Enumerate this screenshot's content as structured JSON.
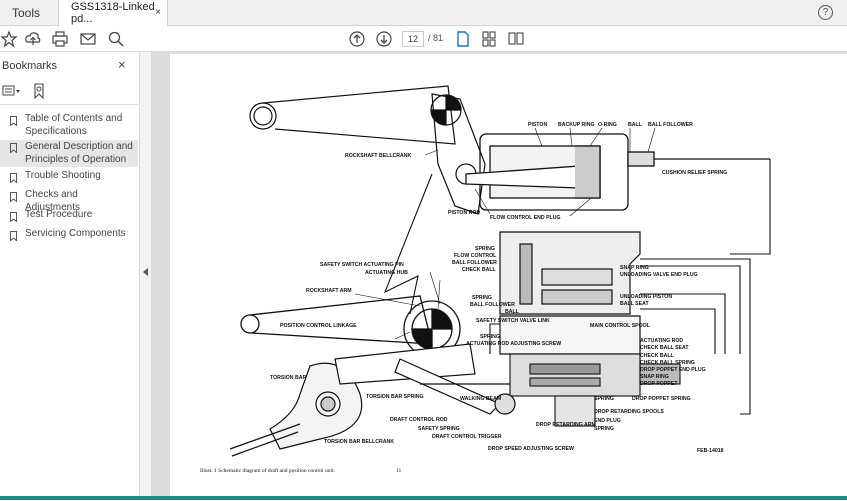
{
  "tabs": {
    "tools": "Tools",
    "doc_title": "GSS1318-Linked pd...",
    "close": "×"
  },
  "toolbar": {
    "page_current": "12",
    "page_total": "/ 81",
    "help": "?"
  },
  "sidebar": {
    "title": "Bookmarks",
    "close": "×",
    "items": [
      {
        "label": "Table of Contents and Specifications",
        "selected": false
      },
      {
        "label": "General Description and Principles of Operation",
        "selected": true
      },
      {
        "label": "Trouble Shooting",
        "selected": false
      },
      {
        "label": "Checks and Adjustments",
        "selected": false
      },
      {
        "label": "Test Procedure",
        "selected": false
      },
      {
        "label": "Servicing Components",
        "selected": false
      }
    ]
  },
  "document": {
    "labels": {
      "piston": "PISTON",
      "backup_ring": "BACKUP RING",
      "o_ring": "O-RING",
      "ball": "BALL",
      "ball_follower_top": "BALL FOLLOWER",
      "rockshaft_bellcrank": "ROCKSHAFT BELLCRANK",
      "cushion_relief_spring": "CUSHION RELIEF SPRING",
      "piston_rod": "PISTON ROD",
      "flow_control_end_plug": "FLOW CONTROL END PLUG",
      "spring_1": "SPRING",
      "flow_control": "FLOW CONTROL",
      "ball_follower_2": "BALL FOLLOWER",
      "check_ball_1": "CHECK BALL",
      "snap_ring_1": "SNAP RING",
      "unloading_valve_end_plug": "UNLOADING VALVE END PLUG",
      "safety_switch_actuating_pin": "SAFETY SWITCH ACTUATING PIN",
      "actuating_hub": "ACTUATING HUB",
      "unloading_piston": "UNLOADING PISTON",
      "ball_seat": "BALL SEAT",
      "rockshaft_arm": "ROCKSHAFT ARM",
      "spring_2": "SPRING",
      "ball_follower_3": "BALL FOLLOWER",
      "ball_2": "BALL",
      "safety_switch_valve_link": "SAFETY SWITCH VALVE LINK",
      "position_control_linkage": "POSITION CONTROL LINKAGE",
      "main_control_spool": "MAIN CONTROL SPOOL",
      "spring_3": "SPRING",
      "actuating_rod_adjusting_screw": "ACTUATING ROD ADJUSTING SCREW",
      "actuating_rod": "ACTUATING ROD",
      "check_ball_seat": "CHECK BALL SEAT",
      "check_ball_2": "CHECK BALL",
      "check_ball_spring": "CHECK BALL SPRING",
      "drop_poppet_end_plug": "DROP POPPET END PLUG",
      "snap_ring_2": "SNAP RING",
      "drop_poppet": "DROP POPPET",
      "torsion_bar": "TORSION BAR",
      "walking_beam": "WALKING BEAM",
      "spring_4": "SPRING",
      "drop_poppet_spring": "DROP POPPET SPRING",
      "drop_retarding_spools": "DROP RETARDING SPOOLS",
      "torsion_bar_spring": "TORSION BAR SPRING",
      "draft_control_rod": "DRAFT CONTROL ROD",
      "drop_retarding_arm": "DROP RETARDING ARM",
      "end_plug": "END PLUG",
      "spring_5": "SPRING",
      "safety_spring": "SAFETY SPRING",
      "draft_control_trigger": "DRAFT CONTROL TRIGGER",
      "torsion_bar_bellcrank": "TORSION BAR BELLCRANK",
      "drop_speed_adjusting_screw": "DROP SPEED ADJUSTING SCREW",
      "fig_code": "FEB-14018"
    },
    "caption": "Illust. 1  Schematic diagram of draft and position control unit.",
    "page_number": "11"
  },
  "colors": {
    "accent": "#1f8a8a",
    "selected_bg": "#e6e6e6",
    "viewer_bg": "#dcdcdc"
  }
}
